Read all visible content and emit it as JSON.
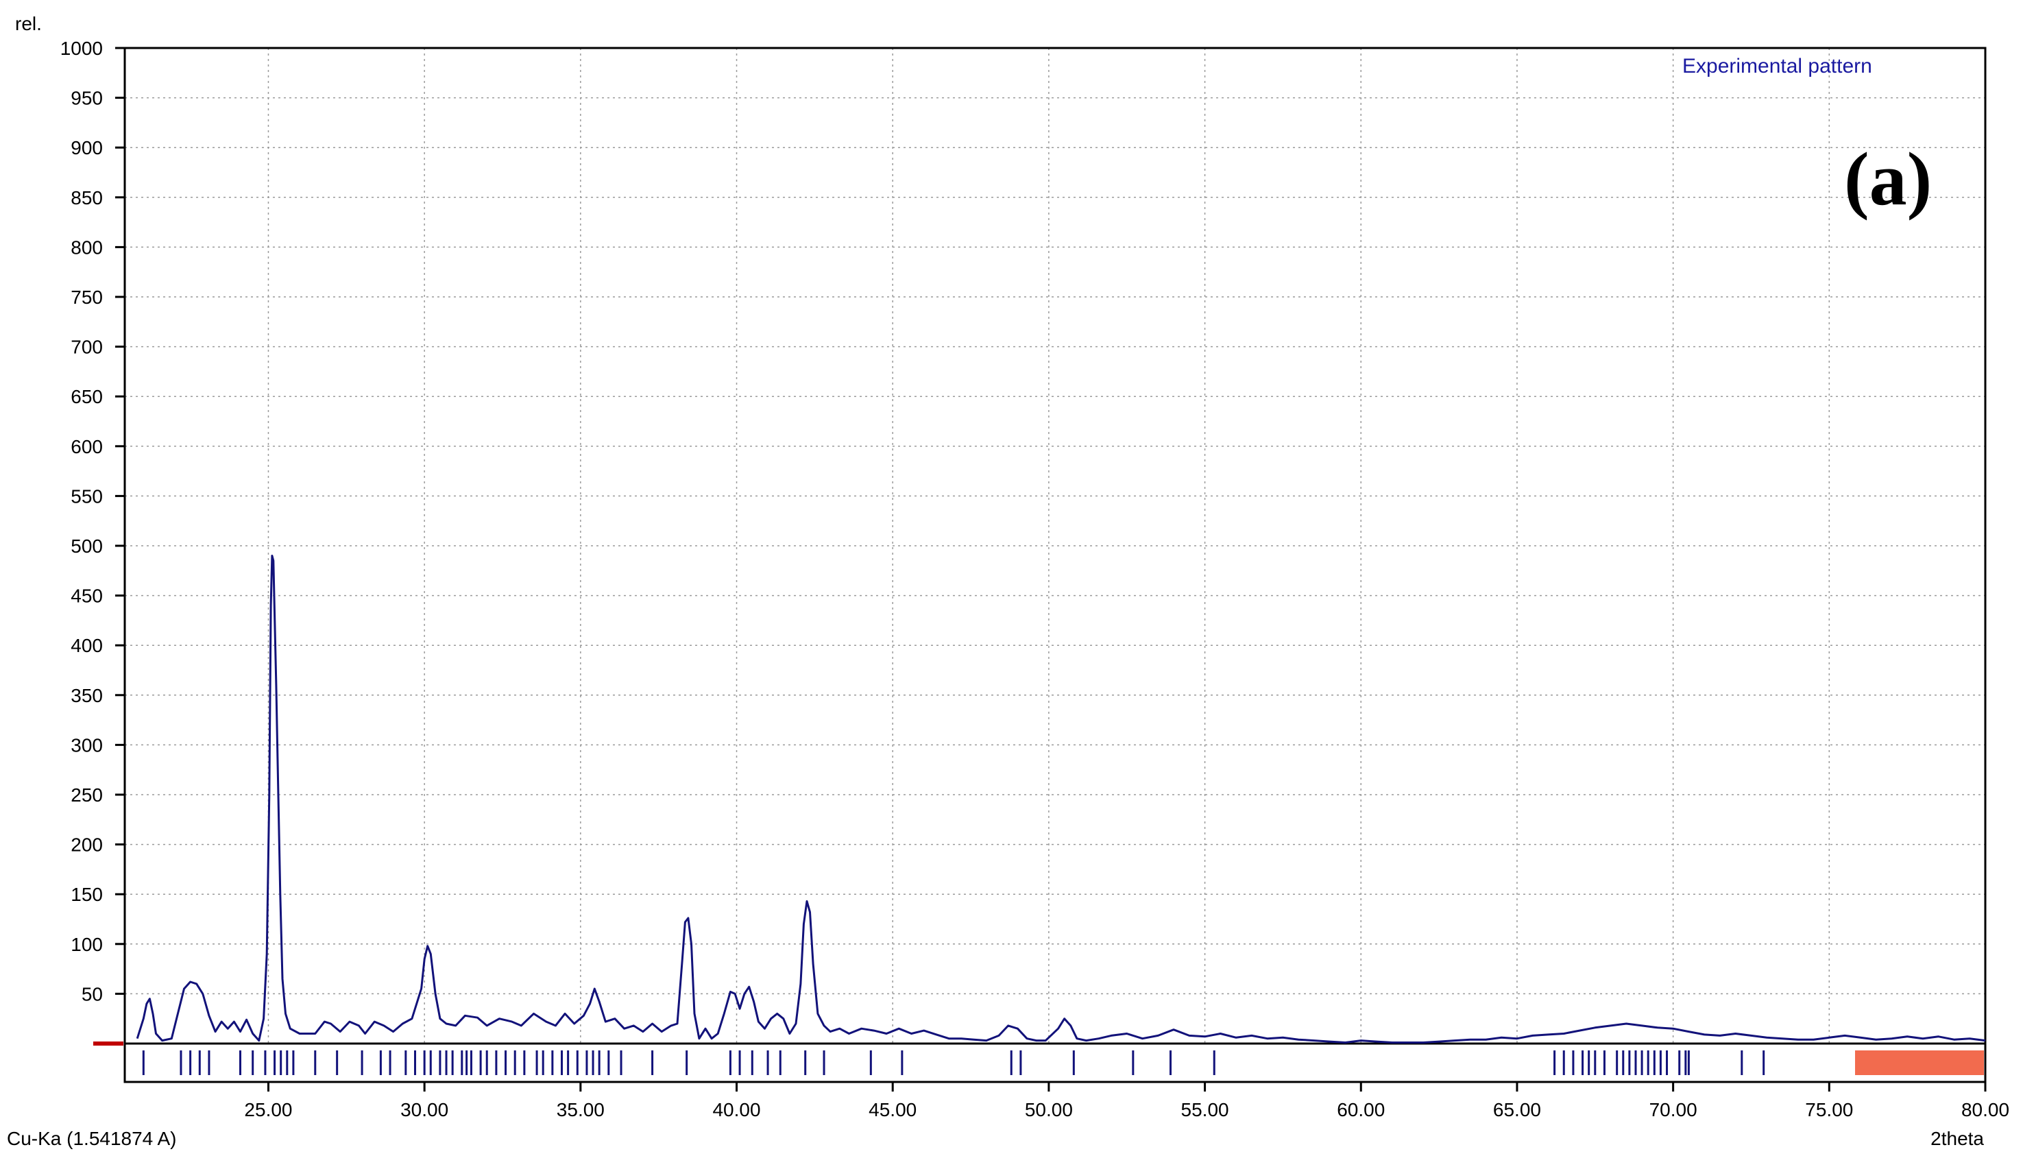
{
  "chart_data": {
    "type": "line",
    "y_unit_label": "rel.",
    "xlabel": "2theta",
    "radiation_label": "Cu-Ka (1.541874 A)",
    "legend": "Experimental pattern",
    "panel_label": "(a)",
    "xlim": [
      20.4,
      80
    ],
    "ylim": [
      0,
      1000
    ],
    "x_ticks": [
      "25.00",
      "30.00",
      "35.00",
      "40.00",
      "45.00",
      "50.00",
      "55.00",
      "60.00",
      "65.00",
      "70.00",
      "75.00",
      "80.00"
    ],
    "y_ticks": [
      "50",
      "100",
      "150",
      "200",
      "250",
      "300",
      "350",
      "400",
      "450",
      "500",
      "550",
      "600",
      "650",
      "700",
      "750",
      "800",
      "850",
      "900",
      "950",
      "1000"
    ],
    "grid": true,
    "legend_position": "top-right",
    "series": [
      {
        "name": "Experimental pattern",
        "color": "#12127a",
        "points": [
          [
            20.8,
            5
          ],
          [
            21.0,
            25
          ],
          [
            21.1,
            40
          ],
          [
            21.2,
            45
          ],
          [
            21.3,
            30
          ],
          [
            21.4,
            10
          ],
          [
            21.6,
            3
          ],
          [
            21.9,
            5
          ],
          [
            22.1,
            30
          ],
          [
            22.3,
            55
          ],
          [
            22.5,
            62
          ],
          [
            22.7,
            60
          ],
          [
            22.9,
            50
          ],
          [
            23.1,
            28
          ],
          [
            23.3,
            12
          ],
          [
            23.5,
            22
          ],
          [
            23.7,
            15
          ],
          [
            23.9,
            22
          ],
          [
            24.1,
            12
          ],
          [
            24.3,
            24
          ],
          [
            24.5,
            10
          ],
          [
            24.7,
            3
          ],
          [
            24.85,
            25
          ],
          [
            24.95,
            90
          ],
          [
            25.03,
            250
          ],
          [
            25.08,
            440
          ],
          [
            25.12,
            490
          ],
          [
            25.16,
            485
          ],
          [
            25.2,
            430
          ],
          [
            25.25,
            360
          ],
          [
            25.3,
            280
          ],
          [
            25.38,
            150
          ],
          [
            25.45,
            65
          ],
          [
            25.55,
            30
          ],
          [
            25.7,
            15
          ],
          [
            26.0,
            10
          ],
          [
            26.5,
            10
          ],
          [
            26.8,
            22
          ],
          [
            27.0,
            20
          ],
          [
            27.3,
            12
          ],
          [
            27.6,
            22
          ],
          [
            27.9,
            18
          ],
          [
            28.1,
            10
          ],
          [
            28.4,
            22
          ],
          [
            28.7,
            18
          ],
          [
            29.0,
            12
          ],
          [
            29.3,
            20
          ],
          [
            29.6,
            25
          ],
          [
            29.9,
            55
          ],
          [
            30.0,
            85
          ],
          [
            30.1,
            98
          ],
          [
            30.2,
            90
          ],
          [
            30.35,
            50
          ],
          [
            30.5,
            25
          ],
          [
            30.7,
            20
          ],
          [
            31.0,
            18
          ],
          [
            31.3,
            28
          ],
          [
            31.7,
            26
          ],
          [
            32.0,
            18
          ],
          [
            32.4,
            25
          ],
          [
            32.8,
            22
          ],
          [
            33.1,
            18
          ],
          [
            33.5,
            30
          ],
          [
            33.9,
            22
          ],
          [
            34.2,
            18
          ],
          [
            34.5,
            30
          ],
          [
            34.8,
            20
          ],
          [
            35.1,
            28
          ],
          [
            35.3,
            40
          ],
          [
            35.45,
            55
          ],
          [
            35.6,
            42
          ],
          [
            35.8,
            22
          ],
          [
            36.1,
            25
          ],
          [
            36.4,
            15
          ],
          [
            36.7,
            18
          ],
          [
            37.0,
            12
          ],
          [
            37.3,
            20
          ],
          [
            37.6,
            12
          ],
          [
            37.9,
            18
          ],
          [
            38.1,
            20
          ],
          [
            38.25,
            80
          ],
          [
            38.35,
            122
          ],
          [
            38.45,
            126
          ],
          [
            38.55,
            100
          ],
          [
            38.65,
            30
          ],
          [
            38.8,
            5
          ],
          [
            39.0,
            15
          ],
          [
            39.2,
            5
          ],
          [
            39.4,
            10
          ],
          [
            39.6,
            30
          ],
          [
            39.8,
            52
          ],
          [
            39.95,
            50
          ],
          [
            40.1,
            35
          ],
          [
            40.25,
            50
          ],
          [
            40.4,
            57
          ],
          [
            40.55,
            42
          ],
          [
            40.7,
            22
          ],
          [
            40.9,
            15
          ],
          [
            41.1,
            25
          ],
          [
            41.3,
            30
          ],
          [
            41.5,
            25
          ],
          [
            41.7,
            10
          ],
          [
            41.9,
            20
          ],
          [
            42.05,
            60
          ],
          [
            42.15,
            120
          ],
          [
            42.25,
            143
          ],
          [
            42.35,
            132
          ],
          [
            42.45,
            80
          ],
          [
            42.6,
            30
          ],
          [
            42.8,
            18
          ],
          [
            43.0,
            12
          ],
          [
            43.3,
            15
          ],
          [
            43.6,
            10
          ],
          [
            44.0,
            15
          ],
          [
            44.4,
            13
          ],
          [
            44.8,
            10
          ],
          [
            45.2,
            15
          ],
          [
            45.6,
            10
          ],
          [
            46.0,
            13
          ],
          [
            46.4,
            9
          ],
          [
            46.8,
            5
          ],
          [
            47.2,
            5
          ],
          [
            47.6,
            4
          ],
          [
            48.0,
            3
          ],
          [
            48.4,
            8
          ],
          [
            48.7,
            18
          ],
          [
            49.0,
            15
          ],
          [
            49.3,
            5
          ],
          [
            49.6,
            3
          ],
          [
            49.9,
            3
          ],
          [
            50.3,
            15
          ],
          [
            50.5,
            25
          ],
          [
            50.7,
            18
          ],
          [
            50.9,
            5
          ],
          [
            51.2,
            3
          ],
          [
            51.6,
            5
          ],
          [
            52.0,
            8
          ],
          [
            52.5,
            10
          ],
          [
            53.0,
            5
          ],
          [
            53.5,
            8
          ],
          [
            54.0,
            14
          ],
          [
            54.5,
            8
          ],
          [
            55.0,
            7
          ],
          [
            55.5,
            10
          ],
          [
            56.0,
            6
          ],
          [
            56.5,
            8
          ],
          [
            57.0,
            5
          ],
          [
            57.5,
            6
          ],
          [
            58.0,
            4
          ],
          [
            58.5,
            3
          ],
          [
            59.0,
            2
          ],
          [
            59.5,
            1
          ],
          [
            60.0,
            3
          ],
          [
            60.5,
            2
          ],
          [
            61.0,
            1
          ],
          [
            61.5,
            1
          ],
          [
            62.0,
            1
          ],
          [
            62.5,
            2
          ],
          [
            63.0,
            3
          ],
          [
            63.5,
            4
          ],
          [
            64.0,
            4
          ],
          [
            64.5,
            6
          ],
          [
            65.0,
            5
          ],
          [
            65.5,
            8
          ],
          [
            66.0,
            9
          ],
          [
            66.5,
            10
          ],
          [
            67.0,
            13
          ],
          [
            67.5,
            16
          ],
          [
            68.0,
            18
          ],
          [
            68.5,
            20
          ],
          [
            69.0,
            18
          ],
          [
            69.5,
            16
          ],
          [
            70.0,
            15
          ],
          [
            70.5,
            12
          ],
          [
            71.0,
            9
          ],
          [
            71.5,
            8
          ],
          [
            72.0,
            10
          ],
          [
            72.5,
            8
          ],
          [
            73.0,
            6
          ],
          [
            73.5,
            5
          ],
          [
            74.0,
            4
          ],
          [
            74.5,
            4
          ],
          [
            75.0,
            6
          ],
          [
            75.5,
            8
          ],
          [
            76.0,
            6
          ],
          [
            76.5,
            4
          ],
          [
            77.0,
            5
          ],
          [
            77.5,
            7
          ],
          [
            78.0,
            5
          ],
          [
            78.5,
            7
          ],
          [
            79.0,
            4
          ],
          [
            79.5,
            5
          ],
          [
            80.0,
            3
          ]
        ]
      }
    ],
    "reference_peak_positions": [
      21.0,
      22.2,
      22.5,
      22.8,
      23.1,
      24.1,
      24.5,
      24.9,
      25.2,
      25.4,
      25.6,
      25.8,
      26.5,
      27.2,
      28.0,
      28.6,
      28.9,
      29.4,
      29.7,
      30.0,
      30.2,
      30.5,
      30.7,
      30.9,
      31.2,
      31.35,
      31.5,
      31.8,
      32.0,
      32.3,
      32.6,
      32.9,
      33.2,
      33.6,
      33.8,
      34.1,
      34.4,
      34.6,
      34.9,
      35.2,
      35.4,
      35.6,
      35.9,
      36.3,
      37.3,
      38.4,
      39.8,
      40.1,
      40.5,
      41.0,
      41.4,
      42.2,
      42.8,
      44.3,
      45.3,
      48.8,
      49.1,
      50.8,
      52.7,
      53.9,
      55.3,
      66.2,
      66.5,
      66.8,
      67.1,
      67.3,
      67.5,
      67.8,
      68.2,
      68.4,
      68.6,
      68.8,
      69.0,
      69.2,
      69.4,
      69.6,
      69.8,
      70.2,
      70.4,
      70.5,
      72.2,
      72.9
    ]
  }
}
